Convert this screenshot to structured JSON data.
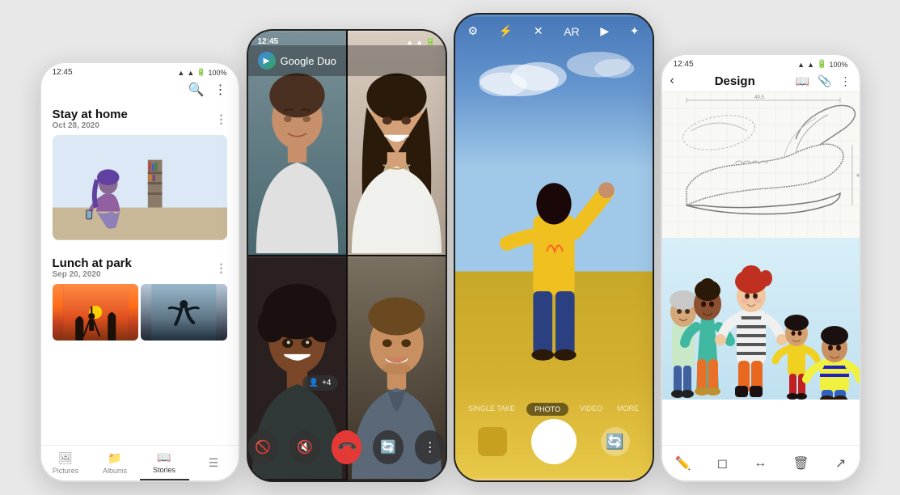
{
  "phone1": {
    "status": {
      "time": "12:45",
      "signal": "▲▲▲▲",
      "battery": "100%"
    },
    "album1": {
      "title": "Stay at home",
      "date": "Oct 28, 2020"
    },
    "album2": {
      "title": "Lunch at park",
      "date": "Sep 20, 2020"
    },
    "nav": {
      "pictures": "Pictures",
      "albums": "Albums",
      "stories": "Stories"
    }
  },
  "phone2": {
    "status": {
      "time": "12:45"
    },
    "app": "Google Duo",
    "controls": {
      "video_off": "📵",
      "mute": "🔇",
      "end_call": "📞",
      "flip": "🔄",
      "more": "⋮"
    }
  },
  "phone3": {
    "modes": [
      "SINGLE TAKE",
      "PHOTO",
      "VIDEO",
      "MORE"
    ],
    "active_mode": "PHOTO"
  },
  "phone4": {
    "status": {
      "time": "12:45",
      "battery": "100%"
    },
    "title": "Design",
    "tools": [
      "✏️",
      "◻",
      "↕",
      "🗑"
    ]
  }
}
